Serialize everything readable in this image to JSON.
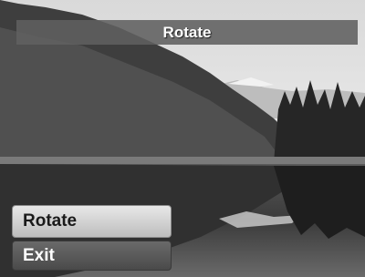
{
  "header": {
    "title": "Rotate"
  },
  "menu": {
    "items": [
      {
        "label": "Rotate",
        "state": "highlighted"
      },
      {
        "label": "Exit",
        "state": "normal"
      }
    ]
  },
  "colors": {
    "title_bar": "#606060",
    "menu_highlight": "#cfcfcf",
    "menu_normal": "#5a5a5a",
    "text_light": "#ffffff",
    "text_dark": "#1a1a1a"
  }
}
